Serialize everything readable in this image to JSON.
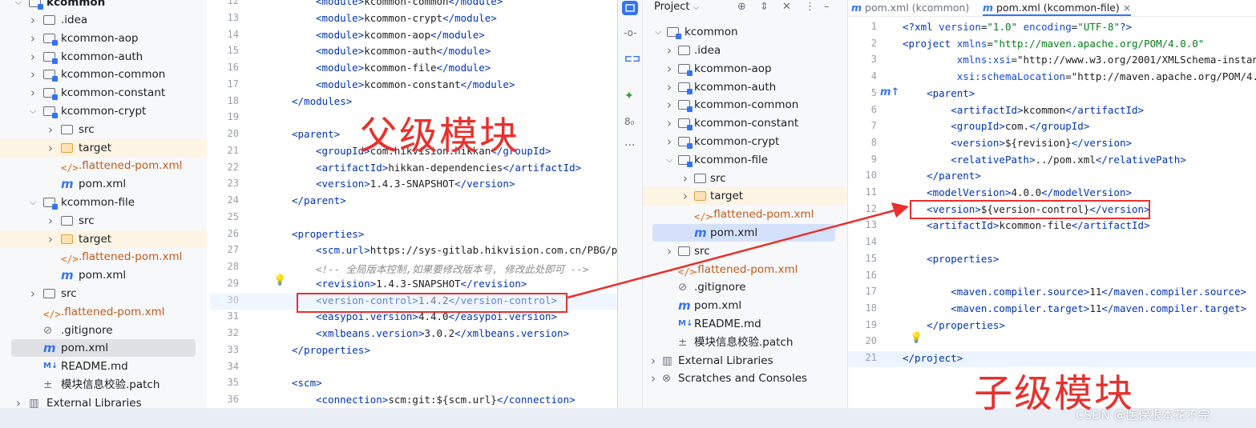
{
  "left_tree": {
    "root": "kcommon",
    "items": [
      {
        "label": ".idea",
        "kind": "folder"
      },
      {
        "label": "kcommon-aop",
        "kind": "module"
      },
      {
        "label": "kcommon-auth",
        "kind": "module"
      },
      {
        "label": "kcommon-common",
        "kind": "module"
      },
      {
        "label": "kcommon-constant",
        "kind": "module"
      },
      {
        "label": "kcommon-crypt",
        "kind": "module"
      },
      {
        "label": "src",
        "kind": "folder"
      },
      {
        "label": "target",
        "kind": "target"
      },
      {
        "label": ".flattened-pom.xml",
        "kind": "xml"
      },
      {
        "label": "pom.xml",
        "kind": "maven"
      },
      {
        "label": "kcommon-file",
        "kind": "module"
      },
      {
        "label": "src",
        "kind": "folder"
      },
      {
        "label": "target",
        "kind": "target"
      },
      {
        "label": ".flattened-pom.xml",
        "kind": "xml"
      },
      {
        "label": "pom.xml",
        "kind": "maven"
      },
      {
        "label": "src",
        "kind": "folder"
      },
      {
        "label": ".flattened-pom.xml",
        "kind": "xml"
      },
      {
        "label": ".gitignore",
        "kind": "ignore"
      },
      {
        "label": "pom.xml",
        "kind": "maven"
      },
      {
        "label": "README.md",
        "kind": "md"
      },
      {
        "label": "模块信息校验.patch",
        "kind": "patch"
      },
      {
        "label": "External Libraries",
        "kind": "lib"
      }
    ]
  },
  "left_code": {
    "lines": [
      {
        "n": "12",
        "text": "<module>kcommon-common</module>"
      },
      {
        "n": "13",
        "text": "<module>kcommon-crypt</module>"
      },
      {
        "n": "14",
        "text": "<module>kcommon-aop</module>"
      },
      {
        "n": "15",
        "text": "<module>kcommon-auth</module>"
      },
      {
        "n": "16",
        "text": "<module>kcommon-file</module>"
      },
      {
        "n": "17",
        "text": "<module>kcommon-constant</module>"
      },
      {
        "n": "18",
        "text": "</modules>"
      },
      {
        "n": "19",
        "text": ""
      },
      {
        "n": "20",
        "text": "<parent>"
      },
      {
        "n": "21",
        "text": "<groupId>com.hikvision.hikkan</groupId>"
      },
      {
        "n": "22",
        "text": "<artifactId>hikkan-dependencies</artifactId>"
      },
      {
        "n": "23",
        "text": "<version>1.4.3-SNAPSHOT</version>"
      },
      {
        "n": "24",
        "text": "</parent>"
      },
      {
        "n": "25",
        "text": ""
      },
      {
        "n": "26",
        "text": "<properties>"
      },
      {
        "n": "27",
        "text": "<scm.url>https://sys-gitlab.hikvision.com.cn/PBG/pre"
      },
      {
        "n": "28",
        "text": "<!-- 全局版本控制,如果要修改版本号, 修改此处即可 -->"
      },
      {
        "n": "29",
        "text": "<revision>1.4.3-SNAPSHOT</revision>"
      },
      {
        "n": "30",
        "text": "<version-control>1.4.2</version-control>"
      },
      {
        "n": "31",
        "text": "<easypoi.version>4.4.0</easypoi.version>"
      },
      {
        "n": "32",
        "text": "<xmlbeans.version>3.0.2</xmlbeans.version>"
      },
      {
        "n": "33",
        "text": "</properties>"
      },
      {
        "n": "34",
        "text": ""
      },
      {
        "n": "35",
        "text": "<scm>"
      },
      {
        "n": "36",
        "text": "<connection>scm:git:${scm.url}</connection>"
      }
    ]
  },
  "label_parent": "父级模块",
  "label_child": "子级模块",
  "right_header": {
    "project_label": "Project",
    "tab1": "pom.xml (kcommon)",
    "tab2": "pom.xml (kcommon-file)",
    "tab2_close": "×"
  },
  "right_tree": {
    "root": "kcommon",
    "items": [
      {
        "label": ".idea",
        "kind": "folder"
      },
      {
        "label": "kcommon-aop",
        "kind": "module"
      },
      {
        "label": "kcommon-auth",
        "kind": "module"
      },
      {
        "label": "kcommon-common",
        "kind": "module"
      },
      {
        "label": "kcommon-constant",
        "kind": "module"
      },
      {
        "label": "kcommon-crypt",
        "kind": "module"
      },
      {
        "label": "kcommon-file",
        "kind": "module"
      },
      {
        "label": "src",
        "kind": "folder"
      },
      {
        "label": "target",
        "kind": "target"
      },
      {
        "label": ".flattened-pom.xml",
        "kind": "xml"
      },
      {
        "label": "pom.xml",
        "kind": "maven"
      },
      {
        "label": "src",
        "kind": "folder"
      },
      {
        "label": ".flattened-pom.xml",
        "kind": "xml"
      },
      {
        "label": ".gitignore",
        "kind": "ignore"
      },
      {
        "label": "pom.xml",
        "kind": "maven"
      },
      {
        "label": "README.md",
        "kind": "md"
      },
      {
        "label": "模块信息校验.patch",
        "kind": "patch"
      },
      {
        "label": "External Libraries",
        "kind": "lib"
      },
      {
        "label": "Scratches and Consoles",
        "kind": "scratch"
      }
    ]
  },
  "right_code": {
    "lines": [
      {
        "n": "1",
        "text": "<?xml version=\"1.0\" encoding=\"UTF-8\"?>"
      },
      {
        "n": "2",
        "text": "<project xmlns=\"http://maven.apache.org/POM/4.0.0\""
      },
      {
        "n": "3",
        "text": "         xmlns:xsi=\"http://www.w3.org/2001/XMLSchema-instance"
      },
      {
        "n": "4",
        "text": "         xsi:schemaLocation=\"http://maven.apache.org/POM/4.0."
      },
      {
        "n": "5",
        "text": "    <parent>"
      },
      {
        "n": "6",
        "text": "        <artifactId>kcommon</artifactId>"
      },
      {
        "n": "7",
        "text": "        <groupId>com.</groupId>"
      },
      {
        "n": "8",
        "text": "        <version>${revision}</version>"
      },
      {
        "n": "9",
        "text": "        <relativePath>../pom.xml</relativePath>"
      },
      {
        "n": "10",
        "text": "    </parent>"
      },
      {
        "n": "11",
        "text": "    <modelVersion>4.0.0</modelVersion>"
      },
      {
        "n": "12",
        "text": "    <version>${version-control}</version>"
      },
      {
        "n": "13",
        "text": "    <artifactId>kcommon-file</artifactId>"
      },
      {
        "n": "14",
        "text": ""
      },
      {
        "n": "15",
        "text": "    <properties>"
      },
      {
        "n": "16",
        "text": ""
      },
      {
        "n": "17",
        "text": "        <maven.compiler.source>11</maven.compiler.source>"
      },
      {
        "n": "18",
        "text": "        <maven.compiler.target>11</maven.compiler.target>"
      },
      {
        "n": "19",
        "text": "    </properties>"
      },
      {
        "n": "20",
        "text": ""
      },
      {
        "n": "21",
        "text": "</project>"
      }
    ]
  },
  "watermark": "CSDN @医保根本花不完",
  "colors": {
    "annotation_red": "#e8302d",
    "tag": "#0033b3",
    "value": "#067d17",
    "accent": "#3574f0"
  },
  "icons": {
    "strip": [
      "folder-icon",
      "commit-icon",
      "pull-requests-icon",
      "plugin-icon",
      "structure-icon",
      "more-icon"
    ],
    "header": [
      "target-icon",
      "expand-icon",
      "collapse-icon",
      "more-icon",
      "minimize-icon"
    ]
  }
}
